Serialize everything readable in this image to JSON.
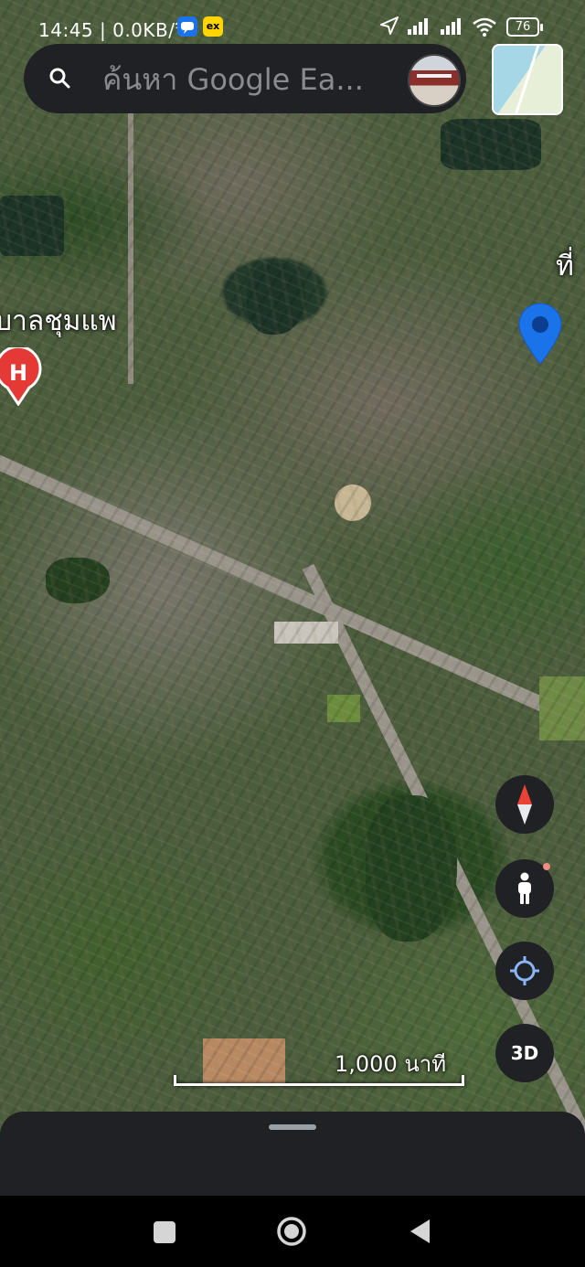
{
  "status_bar": {
    "time": "14:45",
    "network_speed": "0.0KB/วิ",
    "app_badges": [
      "chat-app-icon",
      "ex"
    ],
    "battery": "76"
  },
  "search": {
    "placeholder": "ค้นหา Google Ea..."
  },
  "map": {
    "labels": {
      "hospital": "บาลชุมแพ",
      "edge_fragment": "ที่"
    },
    "hospital_marker": "H",
    "scale": "1,000 นาที"
  },
  "controls": {
    "compass": "compass-icon",
    "street_view": "pegman-icon",
    "my_location": "my-location-icon",
    "view_3d": "3D"
  },
  "navigation": [
    "recents",
    "home",
    "back"
  ],
  "colors": {
    "panel": "#202124",
    "pin_blue": "#1a73e8",
    "hospital_red": "#e53935"
  }
}
